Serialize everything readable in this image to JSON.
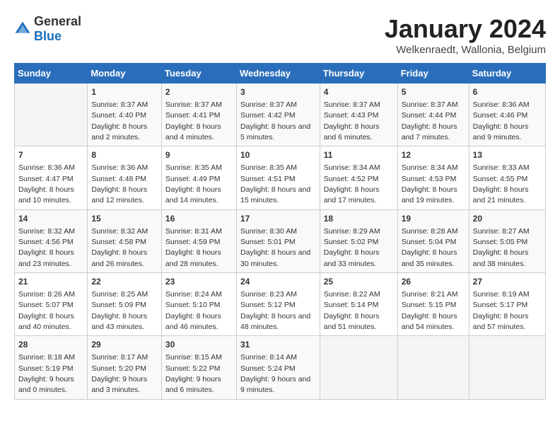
{
  "logo": {
    "general": "General",
    "blue": "Blue"
  },
  "header": {
    "month_title": "January 2024",
    "subtitle": "Welkenraedt, Wallonia, Belgium"
  },
  "weekdays": [
    "Sunday",
    "Monday",
    "Tuesday",
    "Wednesday",
    "Thursday",
    "Friday",
    "Saturday"
  ],
  "weeks": [
    [
      {
        "day": "",
        "sunrise": "",
        "sunset": "",
        "daylight": ""
      },
      {
        "day": "1",
        "sunrise": "Sunrise: 8:37 AM",
        "sunset": "Sunset: 4:40 PM",
        "daylight": "Daylight: 8 hours and 2 minutes."
      },
      {
        "day": "2",
        "sunrise": "Sunrise: 8:37 AM",
        "sunset": "Sunset: 4:41 PM",
        "daylight": "Daylight: 8 hours and 4 minutes."
      },
      {
        "day": "3",
        "sunrise": "Sunrise: 8:37 AM",
        "sunset": "Sunset: 4:42 PM",
        "daylight": "Daylight: 8 hours and 5 minutes."
      },
      {
        "day": "4",
        "sunrise": "Sunrise: 8:37 AM",
        "sunset": "Sunset: 4:43 PM",
        "daylight": "Daylight: 8 hours and 6 minutes."
      },
      {
        "day": "5",
        "sunrise": "Sunrise: 8:37 AM",
        "sunset": "Sunset: 4:44 PM",
        "daylight": "Daylight: 8 hours and 7 minutes."
      },
      {
        "day": "6",
        "sunrise": "Sunrise: 8:36 AM",
        "sunset": "Sunset: 4:46 PM",
        "daylight": "Daylight: 8 hours and 9 minutes."
      }
    ],
    [
      {
        "day": "7",
        "sunrise": "Sunrise: 8:36 AM",
        "sunset": "Sunset: 4:47 PM",
        "daylight": "Daylight: 8 hours and 10 minutes."
      },
      {
        "day": "8",
        "sunrise": "Sunrise: 8:36 AM",
        "sunset": "Sunset: 4:48 PM",
        "daylight": "Daylight: 8 hours and 12 minutes."
      },
      {
        "day": "9",
        "sunrise": "Sunrise: 8:35 AM",
        "sunset": "Sunset: 4:49 PM",
        "daylight": "Daylight: 8 hours and 14 minutes."
      },
      {
        "day": "10",
        "sunrise": "Sunrise: 8:35 AM",
        "sunset": "Sunset: 4:51 PM",
        "daylight": "Daylight: 8 hours and 15 minutes."
      },
      {
        "day": "11",
        "sunrise": "Sunrise: 8:34 AM",
        "sunset": "Sunset: 4:52 PM",
        "daylight": "Daylight: 8 hours and 17 minutes."
      },
      {
        "day": "12",
        "sunrise": "Sunrise: 8:34 AM",
        "sunset": "Sunset: 4:53 PM",
        "daylight": "Daylight: 8 hours and 19 minutes."
      },
      {
        "day": "13",
        "sunrise": "Sunrise: 8:33 AM",
        "sunset": "Sunset: 4:55 PM",
        "daylight": "Daylight: 8 hours and 21 minutes."
      }
    ],
    [
      {
        "day": "14",
        "sunrise": "Sunrise: 8:32 AM",
        "sunset": "Sunset: 4:56 PM",
        "daylight": "Daylight: 8 hours and 23 minutes."
      },
      {
        "day": "15",
        "sunrise": "Sunrise: 8:32 AM",
        "sunset": "Sunset: 4:58 PM",
        "daylight": "Daylight: 8 hours and 26 minutes."
      },
      {
        "day": "16",
        "sunrise": "Sunrise: 8:31 AM",
        "sunset": "Sunset: 4:59 PM",
        "daylight": "Daylight: 8 hours and 28 minutes."
      },
      {
        "day": "17",
        "sunrise": "Sunrise: 8:30 AM",
        "sunset": "Sunset: 5:01 PM",
        "daylight": "Daylight: 8 hours and 30 minutes."
      },
      {
        "day": "18",
        "sunrise": "Sunrise: 8:29 AM",
        "sunset": "Sunset: 5:02 PM",
        "daylight": "Daylight: 8 hours and 33 minutes."
      },
      {
        "day": "19",
        "sunrise": "Sunrise: 8:28 AM",
        "sunset": "Sunset: 5:04 PM",
        "daylight": "Daylight: 8 hours and 35 minutes."
      },
      {
        "day": "20",
        "sunrise": "Sunrise: 8:27 AM",
        "sunset": "Sunset: 5:05 PM",
        "daylight": "Daylight: 8 hours and 38 minutes."
      }
    ],
    [
      {
        "day": "21",
        "sunrise": "Sunrise: 8:26 AM",
        "sunset": "Sunset: 5:07 PM",
        "daylight": "Daylight: 8 hours and 40 minutes."
      },
      {
        "day": "22",
        "sunrise": "Sunrise: 8:25 AM",
        "sunset": "Sunset: 5:09 PM",
        "daylight": "Daylight: 8 hours and 43 minutes."
      },
      {
        "day": "23",
        "sunrise": "Sunrise: 8:24 AM",
        "sunset": "Sunset: 5:10 PM",
        "daylight": "Daylight: 8 hours and 46 minutes."
      },
      {
        "day": "24",
        "sunrise": "Sunrise: 8:23 AM",
        "sunset": "Sunset: 5:12 PM",
        "daylight": "Daylight: 8 hours and 48 minutes."
      },
      {
        "day": "25",
        "sunrise": "Sunrise: 8:22 AM",
        "sunset": "Sunset: 5:14 PM",
        "daylight": "Daylight: 8 hours and 51 minutes."
      },
      {
        "day": "26",
        "sunrise": "Sunrise: 8:21 AM",
        "sunset": "Sunset: 5:15 PM",
        "daylight": "Daylight: 8 hours and 54 minutes."
      },
      {
        "day": "27",
        "sunrise": "Sunrise: 8:19 AM",
        "sunset": "Sunset: 5:17 PM",
        "daylight": "Daylight: 8 hours and 57 minutes."
      }
    ],
    [
      {
        "day": "28",
        "sunrise": "Sunrise: 8:18 AM",
        "sunset": "Sunset: 5:19 PM",
        "daylight": "Daylight: 9 hours and 0 minutes."
      },
      {
        "day": "29",
        "sunrise": "Sunrise: 8:17 AM",
        "sunset": "Sunset: 5:20 PM",
        "daylight": "Daylight: 9 hours and 3 minutes."
      },
      {
        "day": "30",
        "sunrise": "Sunrise: 8:15 AM",
        "sunset": "Sunset: 5:22 PM",
        "daylight": "Daylight: 9 hours and 6 minutes."
      },
      {
        "day": "31",
        "sunrise": "Sunrise: 8:14 AM",
        "sunset": "Sunset: 5:24 PM",
        "daylight": "Daylight: 9 hours and 9 minutes."
      },
      {
        "day": "",
        "sunrise": "",
        "sunset": "",
        "daylight": ""
      },
      {
        "day": "",
        "sunrise": "",
        "sunset": "",
        "daylight": ""
      },
      {
        "day": "",
        "sunrise": "",
        "sunset": "",
        "daylight": ""
      }
    ]
  ]
}
